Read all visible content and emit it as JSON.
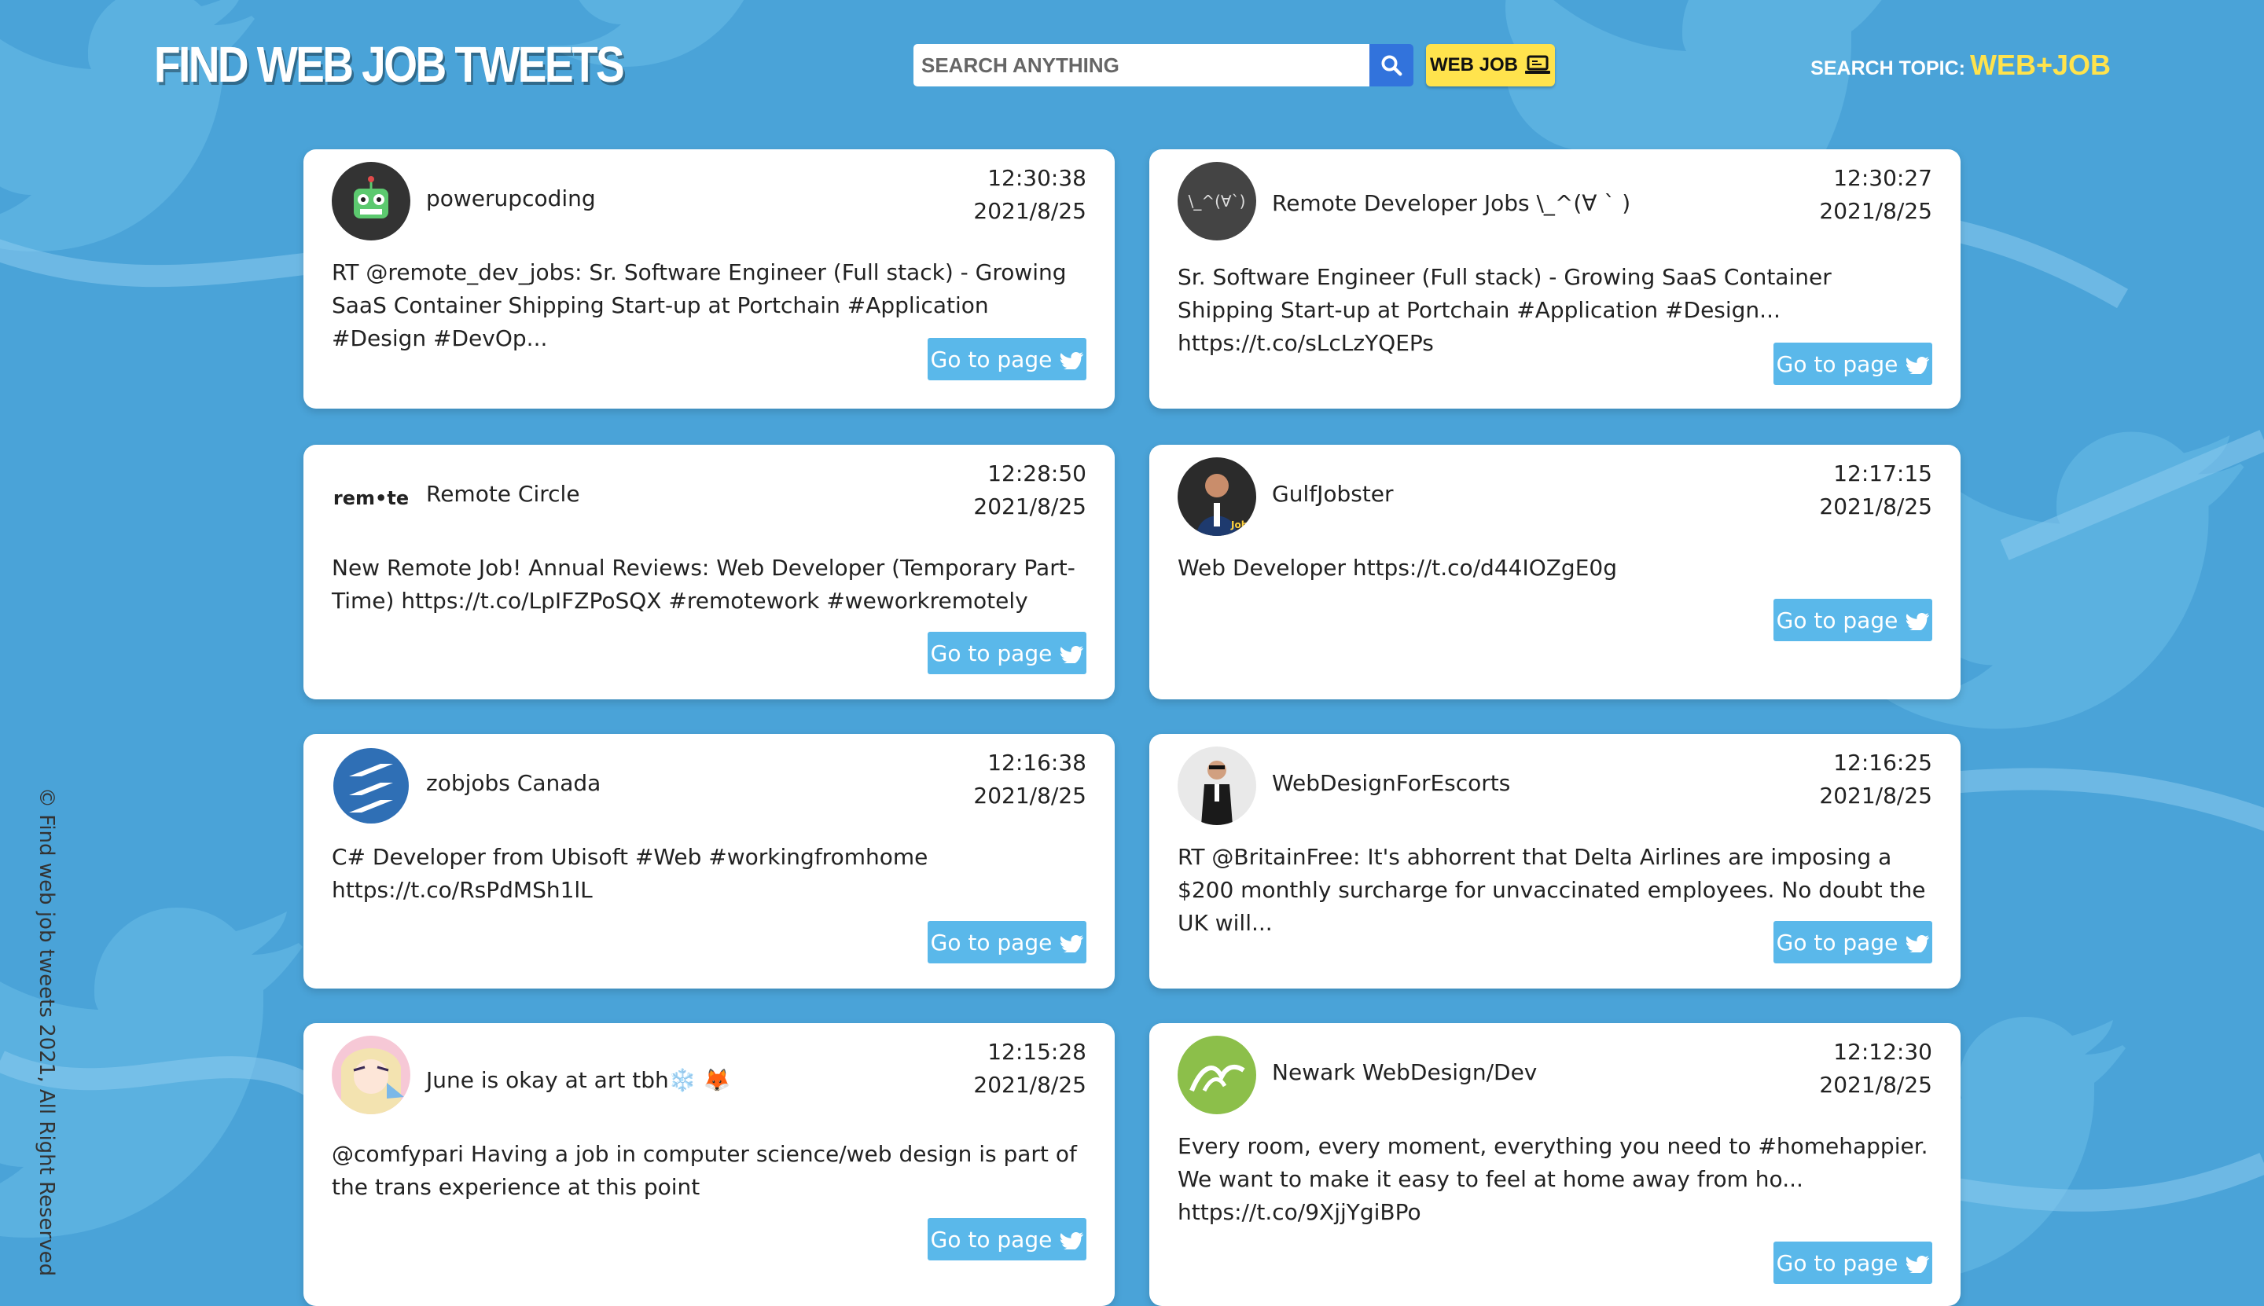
{
  "header": {
    "brand": "FIND WEB JOB TWEETS",
    "search_placeholder": "SEARCH ANYTHING",
    "search_icon": "search-icon",
    "topic_button_label": "WEB JOB",
    "topic_button_icon": "laptop-icon",
    "search_topic_label": "SEARCH TOPIC:",
    "search_topic_value": "WEB+JOB"
  },
  "colors": {
    "background": "#4aa3d8",
    "accent_yellow": "#ffe34d",
    "search_button": "#3273dc",
    "go_button": "#5ab8ea"
  },
  "go_label": "Go to page",
  "go_icon": "twitter-bird-icon",
  "tweets": [
    {
      "user": "powerupcoding",
      "time": "12:30:38",
      "date": "2021/8/25",
      "avatar": "robot-avatar",
      "text": "RT @remote_dev_jobs: Sr. Software Engineer (Full stack) - Growing SaaS Container Shipping Start-up at Portchain #Application #Design #DevOp..."
    },
    {
      "user": "Remote Developer Jobs \\_^(∀ ` )",
      "time": "12:30:27",
      "date": "2021/8/25",
      "avatar": "kaomoji-avatar",
      "text": "Sr. Software Engineer (Full stack) - Growing SaaS Container Shipping Start-up at Portchain #Application #Design... https://t.co/sLcLzYQEPs"
    },
    {
      "user": "Remote Circle",
      "time": "12:28:50",
      "date": "2021/8/25",
      "avatar": "remote-logo-avatar",
      "avatar_text": "rem•te",
      "text": "New Remote Job! Annual Reviews: Web Developer (Temporary Part-Time) https://t.co/LpIFZPoSQX #remotework #weworkremotely"
    },
    {
      "user": "GulfJobster",
      "time": "12:17:15",
      "date": "2021/8/25",
      "avatar": "person-avatar",
      "text": "Web Developer https://t.co/d44IOZgE0g"
    },
    {
      "user": "zobjobs Canada",
      "time": "12:16:38",
      "date": "2021/8/25",
      "avatar": "zobjobs-logo-avatar",
      "text": "C# Developer from Ubisoft #Web #workingfromhome https://t.co/RsPdMSh1lL"
    },
    {
      "user": "WebDesignForEscorts",
      "time": "12:16:25",
      "date": "2021/8/25",
      "avatar": "person-avatar",
      "text": "RT @BritainFree: It's abhorrent that Delta Airlines are imposing a $200 monthly surcharge for unvaccinated employees. No doubt the UK will..."
    },
    {
      "user": "June is okay at art tbh❄️ 🦊",
      "time": "12:15:28",
      "date": "2021/8/25",
      "avatar": "anime-avatar",
      "text": "@comfypari Having a job in computer science/web design is part of the trans experience at this point"
    },
    {
      "user": "Newark WebDesign/Dev",
      "time": "12:12:30",
      "date": "2021/8/25",
      "avatar": "newark-logo-avatar",
      "text": "Every room, every moment, everything you need to #homehappier. We want to make it easy to feel at home away from ho... https://t.co/9XjjYgiBPo"
    }
  ],
  "footer": {
    "copyright": "© Find web job tweets 2021, All Right Reserved"
  }
}
